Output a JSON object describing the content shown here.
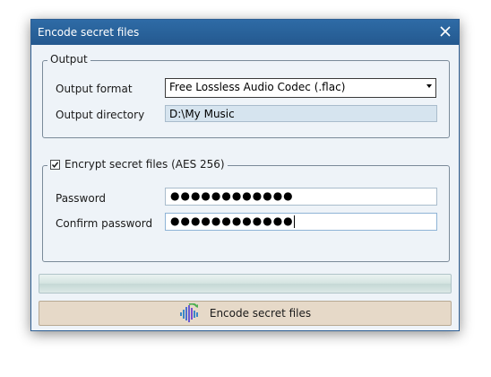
{
  "window": {
    "title": "Encode secret files",
    "close_icon": "close-icon",
    "background": "#eef3f8",
    "titlebar_color": "#24598f"
  },
  "output_group": {
    "legend": "Output",
    "format_label": "Output format",
    "format_value": "Free Lossless Audio Codec (.flac)",
    "directory_label": "Output directory",
    "directory_value": "D:\\My Music"
  },
  "encrypt_group": {
    "checkbox_label": "Encrypt secret files (AES 256)",
    "checked": true,
    "password_label": "Password",
    "password_value": "●●●●●●●●●●●●",
    "confirm_label": "Confirm password",
    "confirm_value": "●●●●●●●●●●●●"
  },
  "progress": {
    "value": 0
  },
  "encode_button": {
    "label": "Encode secret files",
    "icon": "audio-waveform-icon",
    "color": "#e6d9c8"
  }
}
